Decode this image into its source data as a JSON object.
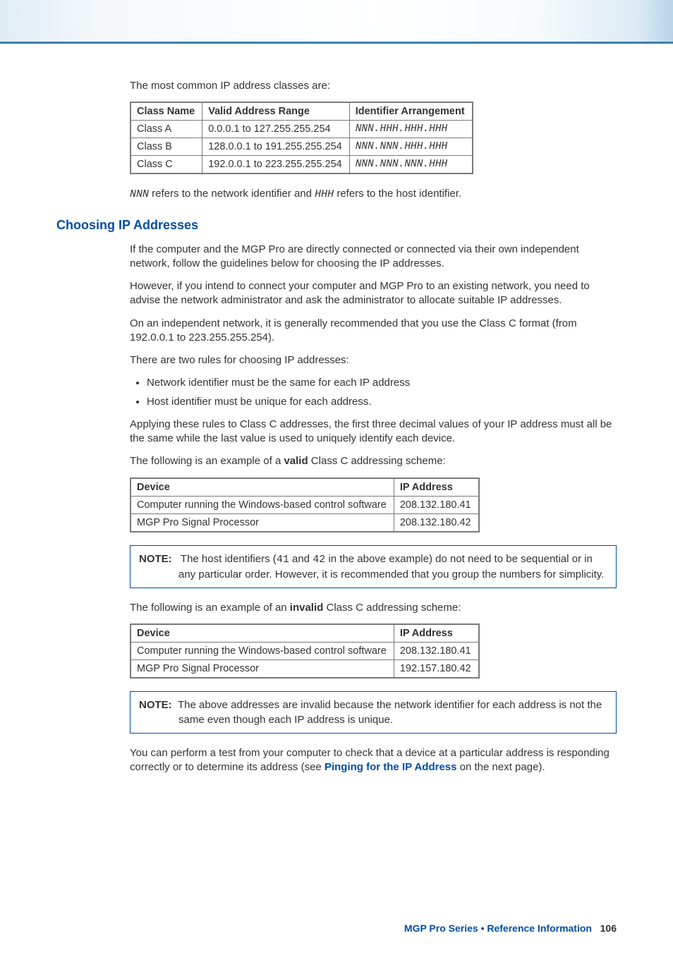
{
  "intro": "The most common IP address classes are:",
  "table1": {
    "headers": [
      "Class Name",
      "Valid Address Range",
      "Identifier Arrangement"
    ],
    "rows": [
      [
        "Class A",
        "0.0.0.1 to 127.255.255.254",
        "NNN.HHH.HHH.HHH"
      ],
      [
        "Class B",
        "128.0.0.1 to 191.255.255.254",
        "NNN.NNN.HHH.HHH"
      ],
      [
        "Class C",
        "192.0.0.1 to 223.255.255.254",
        "NNN.NNN.NNN.HHH"
      ]
    ]
  },
  "legend_nnn": "NNN",
  "legend_mid": " refers to the network identifier and ",
  "legend_hhh": "HHH",
  "legend_end": " refers to the host identifier.",
  "section_title": "Choosing IP Addresses",
  "p1": "If the computer and the MGP Pro are directly connected or connected via their own independent network, follow the guidelines below for choosing the IP addresses.",
  "p2": "However, if you intend to connect your computer and MGP Pro to an existing network, you need to advise the network administrator and ask the administrator to allocate suitable IP addresses.",
  "p3": "On an independent network, it is generally recommended that you use the Class C format (from 192.0.0.1 to 223.255.255.254).",
  "p4": "There are two rules for choosing IP addresses:",
  "rules": [
    "Network identifier must be the same for each IP address",
    "Host identifier must be unique for each address."
  ],
  "p5": "Applying these rules to Class C addresses, the first three decimal values of your IP address must all be the same while the last value is used to uniquely identify each device.",
  "p6a": "The following is an example of a ",
  "p6b": "valid",
  "p6c": " Class C addressing scheme:",
  "table2": {
    "headers": [
      "Device",
      "IP Address"
    ],
    "rows": [
      [
        "Computer running the Windows-based control software",
        "208.132.180.41"
      ],
      [
        "MGP Pro Signal Processor",
        "208.132.180.42"
      ]
    ]
  },
  "note1_label": "NOTE:",
  "note1a": "The host identifiers (",
  "note1b": "41",
  "note1c": " and ",
  "note1d": "42",
  "note1e": " in the above example) do not need to be sequential or in any particular order. However, it is recommended that you group the numbers for simplicity.",
  "p7a": "The following is an example of an ",
  "p7b": "invalid",
  "p7c": " Class C addressing scheme:",
  "table3": {
    "headers": [
      "Device",
      "IP Address"
    ],
    "rows": [
      [
        "Computer running the Windows-based control software",
        "208.132.180.41"
      ],
      [
        "MGP Pro Signal Processor",
        "192.157.180.42"
      ]
    ]
  },
  "note2_label": "NOTE:",
  "note2": "The above addresses are invalid because the network identifier for each address is not the same even though each IP address is unique.",
  "p8a": "You can perform a test from your computer to check that a device at a particular address is responding correctly or to determine its address (see ",
  "p8b": "Pinging for the IP Address",
  "p8c": " on the next page).",
  "footer_a": "MGP Pro Series • Reference Information",
  "footer_b": "106"
}
